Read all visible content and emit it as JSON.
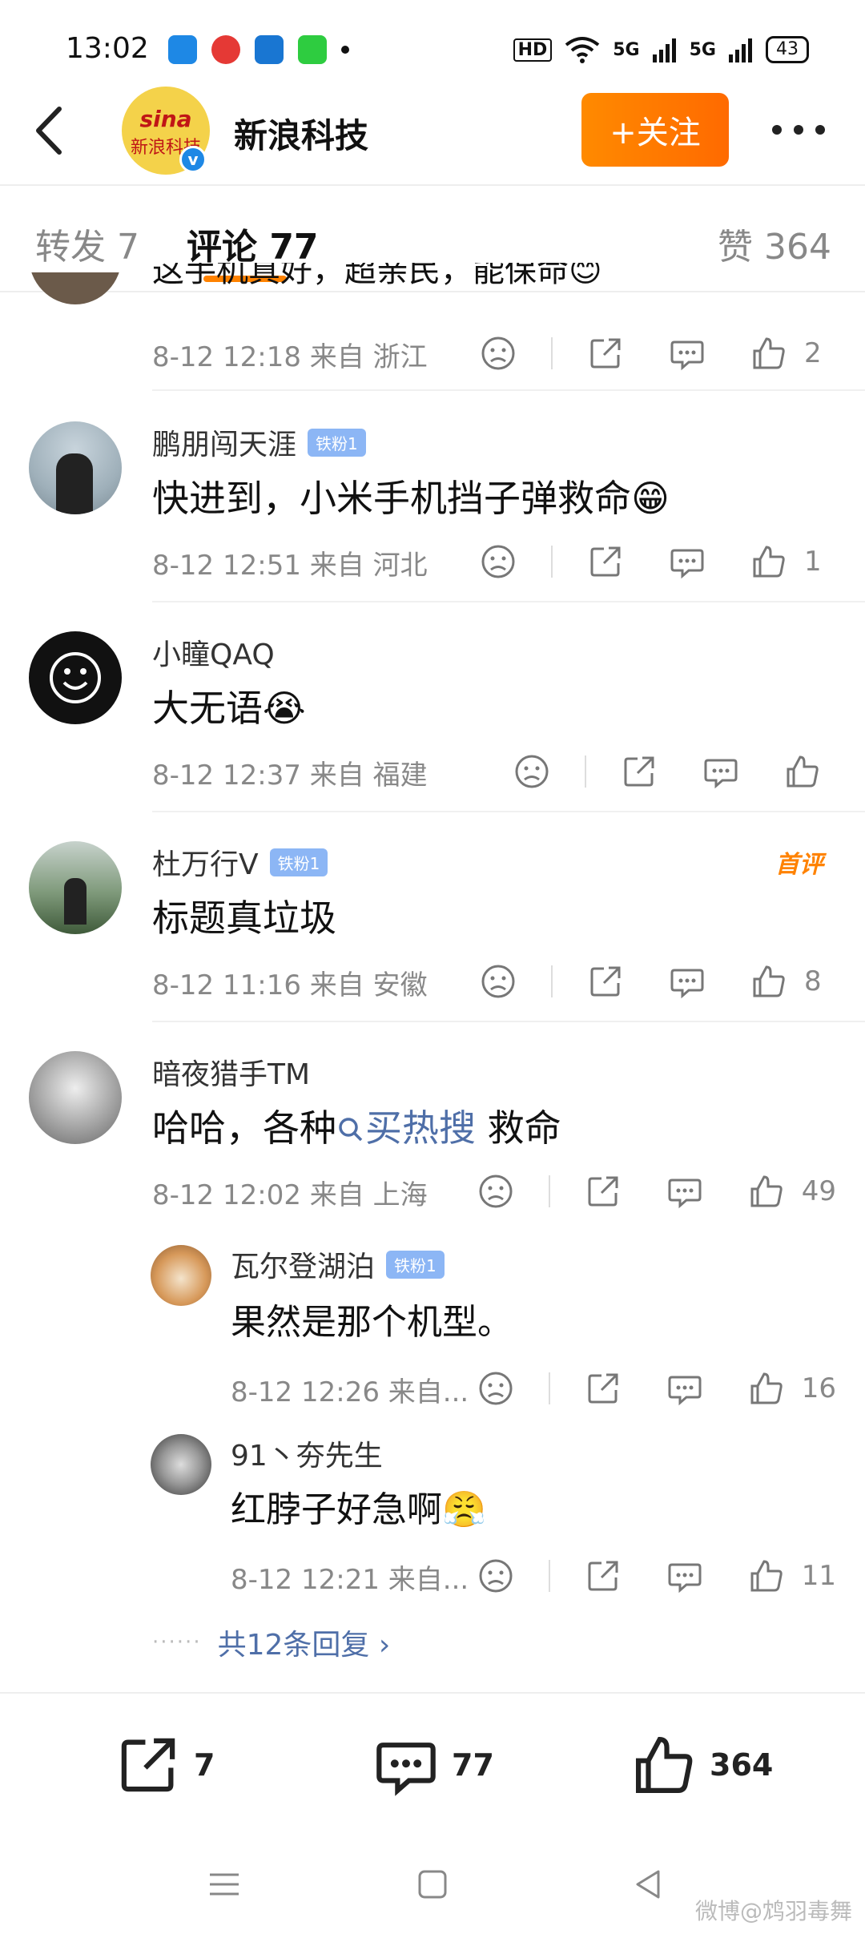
{
  "status_bar": {
    "time": "13:02",
    "network_1": "5G",
    "network_2": "5G",
    "hd_label": "HD",
    "battery": "43",
    "app_colors": [
      "#1e88e5",
      "#e53935",
      "#1976d2",
      "#2ecc40"
    ]
  },
  "header": {
    "title": "新浪科技",
    "avatar_logo": "sina",
    "avatar_sub": "新浪科技",
    "follow_label": "+关注"
  },
  "tabs": {
    "repost": "转发 7",
    "comment": "评论 77",
    "like": "赞 364"
  },
  "comments": [
    {
      "name": "",
      "text": "这手机真好，超亲民，能保命😊",
      "time": "8-12 12:18",
      "source": "来自 浙江",
      "likes": "2"
    },
    {
      "name": "鹏朋闯天涯",
      "badge": "铁粉1",
      "text": "快进到，小米手机挡子弹救命😁",
      "time": "8-12 12:51",
      "source": "来自 河北",
      "likes": "1"
    },
    {
      "name": "小瞳QAQ",
      "text": "大无语😭",
      "time": "8-12 12:37",
      "source": "来自 福建",
      "likes": ""
    },
    {
      "name": "杜万行V",
      "badge": "铁粉1",
      "first_badge": "首评",
      "text": "标题真垃圾",
      "time": "8-12 11:16",
      "source": "来自 安徽",
      "likes": "8"
    },
    {
      "name": "暗夜猎手TM",
      "text_before": "哈哈，各种",
      "hashtag": "买热搜",
      "text_after": " 救命",
      "time": "8-12 12:02",
      "source": "来自 上海",
      "likes": "49"
    }
  ],
  "replies": [
    {
      "name": "瓦尔登湖泊",
      "badge": "铁粉1",
      "text": "果然是那个机型。",
      "time": "8-12 12:26",
      "source": "来自...",
      "likes": "16"
    },
    {
      "name": "91丶夯先生",
      "text": "红脖子好急啊😤",
      "time": "8-12 12:21",
      "source": "来自...",
      "likes": "11"
    }
  ],
  "more_replies": {
    "dots": "······",
    "label": "共12条回复 ›"
  },
  "bottom_bar": {
    "repost_count": "7",
    "comment_count": "77",
    "like_count": "364"
  },
  "watermark": "微博@鸩羽毒舞",
  "colors": {
    "accent": "#ff8200",
    "link": "#4f6fa8",
    "fan_badge": "#8cb6f5"
  }
}
